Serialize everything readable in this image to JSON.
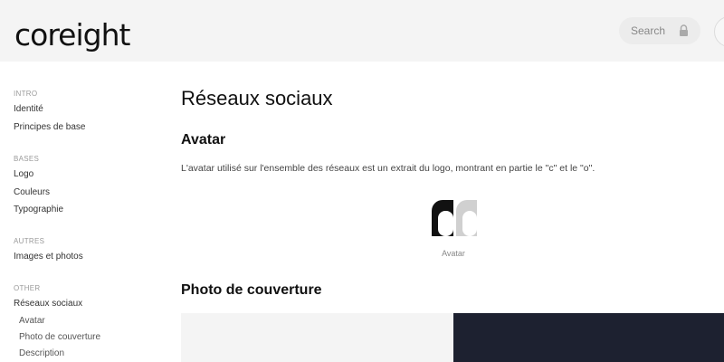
{
  "header": {
    "logo_text": "coreight",
    "search": {
      "placeholder": "Search"
    }
  },
  "sidebar": {
    "sections": [
      {
        "title": "INTRO",
        "items": [
          "Identité",
          "Principes de base"
        ]
      },
      {
        "title": "BASES",
        "items": [
          "Logo",
          "Couleurs",
          "Typographie"
        ]
      },
      {
        "title": "AUTRES",
        "items": [
          "Images et photos"
        ]
      },
      {
        "title": "OTHER",
        "items": [
          "Réseaux sociaux"
        ]
      }
    ],
    "subitems": [
      "Avatar",
      "Photo de couverture",
      "Description"
    ]
  },
  "main": {
    "title": "Réseaux sociaux",
    "avatar_heading": "Avatar",
    "avatar_description": "L'avatar utilisé sur l'ensemble des réseaux est un extrait du logo, montrant en partie le \"c\" et le \"o\".",
    "avatar_caption": "Avatar",
    "cover_heading": "Photo de couverture"
  },
  "colors": {
    "header_bg": "#f4f4f4",
    "cover_dark": "#1d2130",
    "cover_light": "#f4f4f4"
  },
  "icons": [
    "lock-icon",
    "avatar-logo-icon"
  ]
}
